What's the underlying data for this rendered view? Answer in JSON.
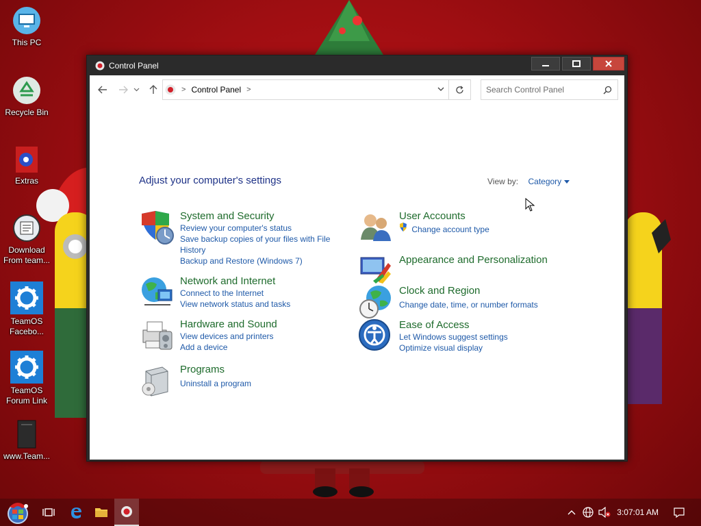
{
  "desktop": {
    "icons": [
      {
        "label": "This PC",
        "icon": "monitor-icon"
      },
      {
        "label": "Recycle Bin",
        "icon": "recycle-bin-icon"
      },
      {
        "label": "Extras",
        "icon": "extras-icon"
      },
      {
        "label": "Download From team...",
        "icon": "download-icon"
      },
      {
        "label": "TeamOS Facebo...",
        "icon": "gear-icon"
      },
      {
        "label": "TeamOS Forum Link",
        "icon": "gear-icon"
      },
      {
        "label": "www.Team...",
        "icon": "file-icon"
      }
    ]
  },
  "window": {
    "title": "Control Panel",
    "address": {
      "crumb": "Control Panel"
    },
    "search": {
      "placeholder": "Search Control Panel"
    },
    "heading": "Adjust your computer's settings",
    "view_by": {
      "label": "View by:",
      "value": "Category"
    },
    "categories_left": [
      {
        "title": "System and Security",
        "links": [
          "Review your computer's status",
          "Save backup copies of your files with File History",
          "Backup and Restore (Windows 7)"
        ]
      },
      {
        "title": "Network and Internet",
        "links": [
          "Connect to the Internet",
          "View network status and tasks"
        ]
      },
      {
        "title": "Hardware and Sound",
        "links": [
          "View devices and printers",
          "Add a device"
        ]
      },
      {
        "title": "Programs",
        "links": [
          "Uninstall a program"
        ]
      }
    ],
    "categories_right": [
      {
        "title": "User Accounts",
        "links": [
          "Change account type"
        ]
      },
      {
        "title": "Appearance and Personalization",
        "links": []
      },
      {
        "title": "Clock and Region",
        "links": [
          "Change date, time, or number formats"
        ]
      },
      {
        "title": "Ease of Access",
        "links": [
          "Let Windows suggest settings",
          "Optimize visual display"
        ]
      }
    ]
  },
  "taskbar": {
    "clock": "3:07:01 AM"
  },
  "colors": {
    "link": "#1e59a8",
    "category_title": "#1e6b2c",
    "heading": "#1e3287",
    "close_button": "#c7463c"
  }
}
